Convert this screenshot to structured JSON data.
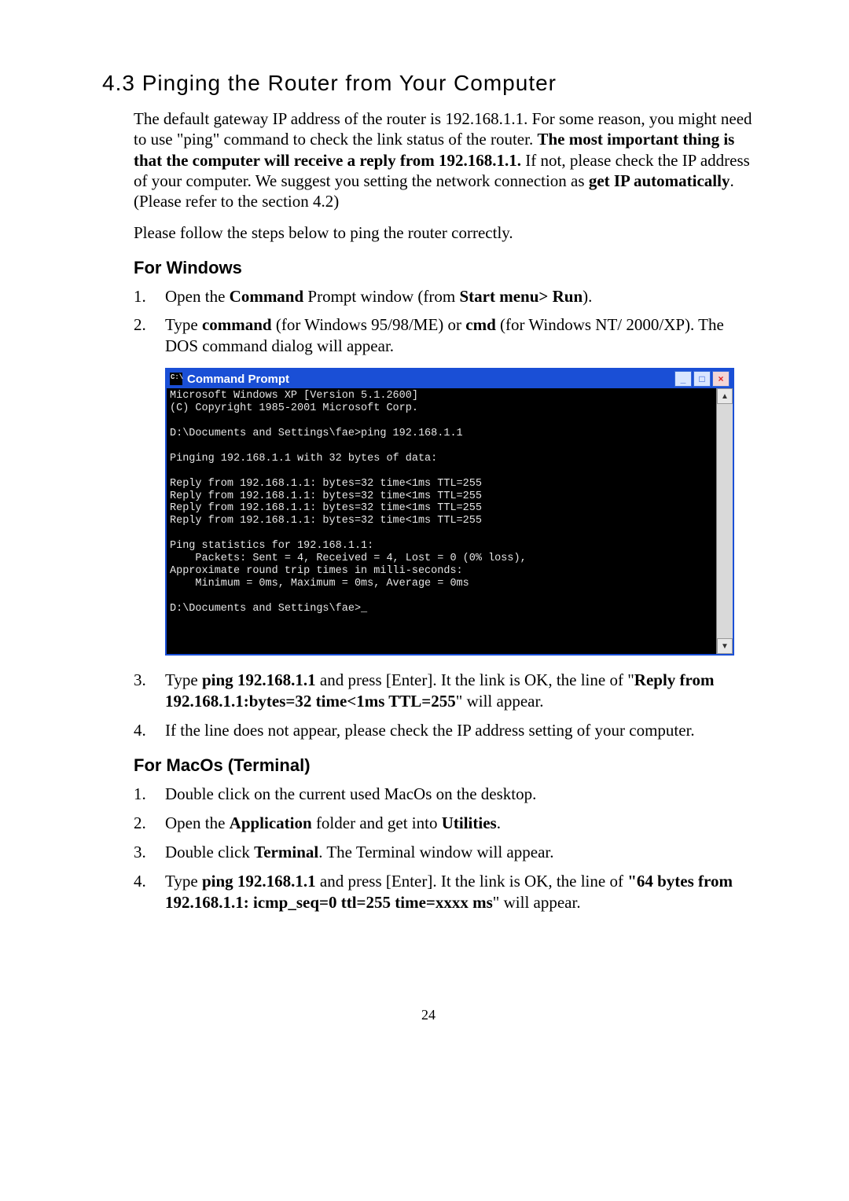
{
  "section": {
    "number": "4.3",
    "title": "Pinging the Router from Your Computer"
  },
  "intro": {
    "p1_a": "The default gateway IP address of the router is 192.168.1.1. For some reason, you might need to use \"ping\" command to check the link status of the router. ",
    "p1_b": "The most important thing is that the computer will receive a reply from 192.168.1.1.",
    "p1_c": " If not, please check the IP address of your computer. We suggest you setting the network connection as ",
    "p1_d": "get IP automatically",
    "p1_e": ". (Please refer to the section 4.2)",
    "p2": "Please follow the steps below to ping the router correctly."
  },
  "windows": {
    "heading": "For Windows",
    "items": [
      {
        "num": "1.",
        "a": "Open the ",
        "b": "Command",
        "c": " Prompt window (from ",
        "d": "Start menu> Run",
        "e": ")."
      },
      {
        "num": "2.",
        "a": "Type ",
        "b": "command",
        "c": " (for Windows 95/98/ME) or ",
        "d": "cmd",
        "e": " (for Windows NT/ 2000/XP). The DOS command dialog will appear."
      }
    ],
    "after_items": [
      {
        "num": "3.",
        "a": "Type ",
        "b": "ping 192.168.1.1",
        "c": " and press [Enter]. It the link is OK, the line of \"",
        "d": "Reply from 192.168.1.1:bytes=32 time<1ms TTL=255",
        "e": "\" will appear."
      },
      {
        "num": "4.",
        "a": "If the line does not appear, please check the IP address setting of your computer."
      }
    ]
  },
  "cmd": {
    "title": "Command Prompt",
    "btn_min": "_",
    "btn_max": "□",
    "btn_close": "×",
    "scroll_up": "▲",
    "scroll_down": "▼",
    "text": "Microsoft Windows XP [Version 5.1.2600]\n(C) Copyright 1985-2001 Microsoft Corp.\n\nD:\\Documents and Settings\\fae>ping 192.168.1.1\n\nPinging 192.168.1.1 with 32 bytes of data:\n\nReply from 192.168.1.1: bytes=32 time<1ms TTL=255\nReply from 192.168.1.1: bytes=32 time<1ms TTL=255\nReply from 192.168.1.1: bytes=32 time<1ms TTL=255\nReply from 192.168.1.1: bytes=32 time<1ms TTL=255\n\nPing statistics for 192.168.1.1:\n    Packets: Sent = 4, Received = 4, Lost = 0 (0% loss),\nApproximate round trip times in milli-seconds:\n    Minimum = 0ms, Maximum = 0ms, Average = 0ms\n\nD:\\Documents and Settings\\fae>_\n\n\n\n"
  },
  "macos": {
    "heading": "For MacOs (Terminal)",
    "items": [
      {
        "num": "1.",
        "a": "Double click on the current used MacOs on the desktop."
      },
      {
        "num": "2.",
        "a": "Open the ",
        "b": "Application",
        "c": " folder and get into ",
        "d": "Utilities",
        "e": "."
      },
      {
        "num": "3.",
        "a": "Double click ",
        "b": "Terminal",
        "c": ". The Terminal window will appear."
      },
      {
        "num": "4.",
        "a": "Type ",
        "b": "ping 192.168.1.1",
        "c": " and press [Enter]. It the link is OK, the line of ",
        "d": "\"64 bytes from 192.168.1.1: icmp_seq=0 ttl=255 time=xxxx ms",
        "e": "\" will appear."
      }
    ]
  },
  "pagenum": "24"
}
